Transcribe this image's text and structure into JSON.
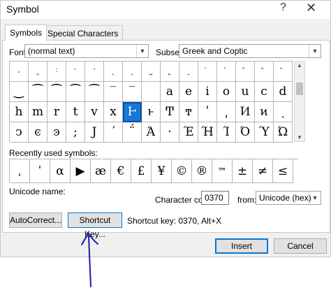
{
  "window": {
    "title": "Symbol",
    "help_label": "?",
    "close_label": "✕"
  },
  "tabs": [
    {
      "label": "Symbols",
      "active": true
    },
    {
      "label": "Special Characters",
      "active": false
    }
  ],
  "font": {
    "label": "Font:",
    "value": "(normal text)"
  },
  "subset": {
    "label": "Subset:",
    "value": "Greek and Coptic"
  },
  "grid_symbols": [
    [
      "˶",
      "˷",
      "˸",
      "˹",
      "˺",
      "˻",
      "˼",
      "˽",
      "˾",
      "˿",
      "̀",
      "́",
      "̂",
      "̃",
      "̄"
    ],
    [
      "‿",
      "⁀",
      "⁀",
      "⁀",
      "⁀",
      "‾",
      "‾",
      "͏",
      "a",
      "e",
      "i",
      "o",
      "u",
      "c",
      "d"
    ],
    [
      "h",
      "m",
      "r",
      "t",
      "v",
      "x",
      "Ͱ",
      "ͱ",
      "Ͳ",
      "ͳ",
      "ʹ",
      "͵",
      "Ͷ",
      "ͷ",
      "ͺ"
    ],
    [
      "ͻ",
      "ͼ",
      "ͽ",
      ";",
      "Ϳ",
      "΄",
      "΅",
      "Ά",
      "·",
      "Έ",
      "Ή",
      "Ί",
      "Ό",
      "Ύ",
      "Ώ"
    ]
  ],
  "selected_cell": {
    "row": 2,
    "col": 6
  },
  "recent": {
    "label": "Recently used symbols:",
    "items": [
      "ˌ",
      "ˈ",
      "α",
      "▶",
      "æ",
      "€",
      "£",
      "¥",
      "©",
      "®",
      "™",
      "±",
      "≠",
      "≤"
    ]
  },
  "unicode_name_label": "Unicode name:",
  "character_code": {
    "label": "Character code:",
    "value": "0370"
  },
  "from": {
    "label": "from:",
    "value": "Unicode (hex)"
  },
  "buttons": {
    "autocorrect": "AutoCorrect...",
    "shortcut_key": "Shortcut Key...",
    "insert": "Insert",
    "cancel": "Cancel"
  },
  "shortcut_info": "Shortcut key: 0370, Alt+X",
  "colors": {
    "selection": "#1679d8",
    "annotation_arrow": "#1a1aa6",
    "focus_border": "#0078d7"
  },
  "icons": {
    "dropdown": "chevron-down-icon",
    "scroll_up": "scroll-up-icon",
    "scroll_down": "scroll-down-icon"
  }
}
